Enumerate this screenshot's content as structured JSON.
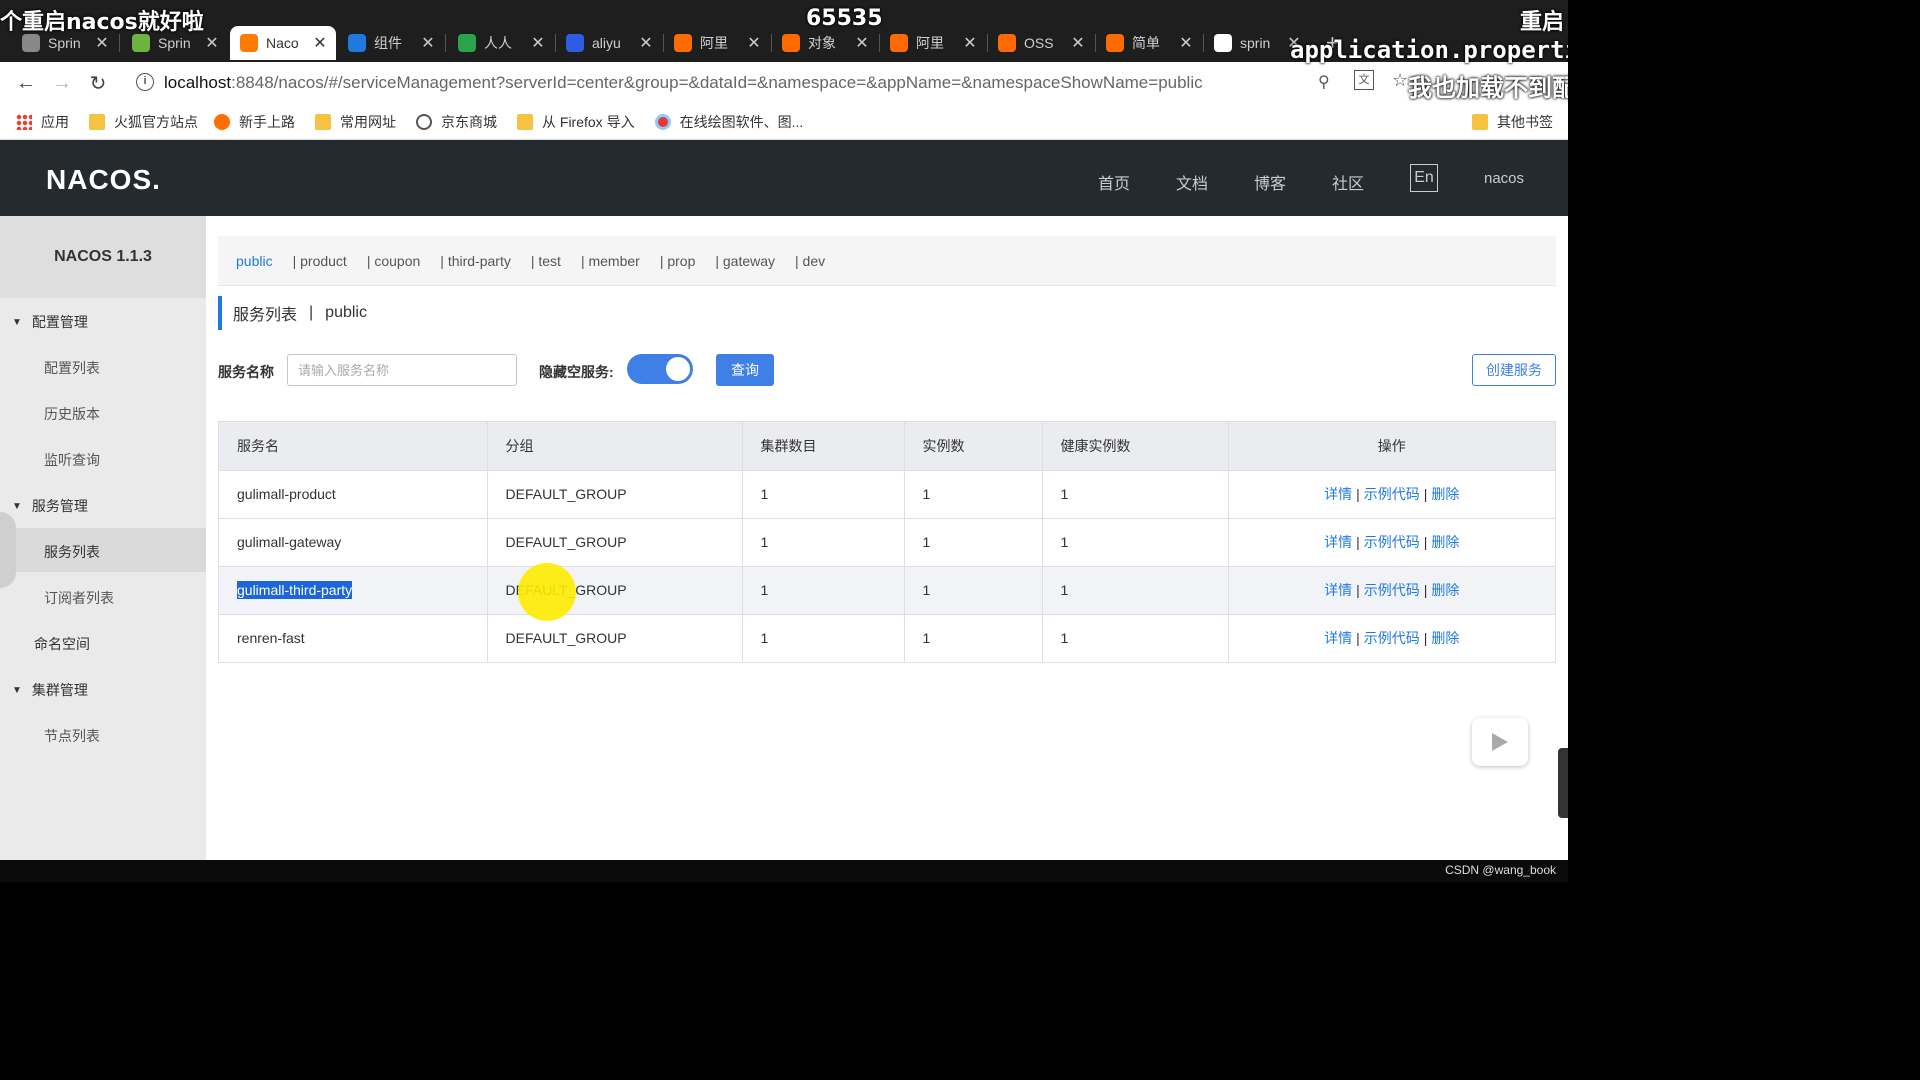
{
  "overlays": {
    "top_left": "个重启nacos就好啦",
    "top_center": "65535",
    "top_right": "重启",
    "right_line1": "application.properties",
    "right_line2": "我也加载不到配"
  },
  "browser": {
    "tabs": [
      {
        "title": "Sprin",
        "icon_color": "#888888"
      },
      {
        "title": "Sprin",
        "icon_color": "#6db33f"
      },
      {
        "title": "Naco",
        "icon_color": "#ff7a00"
      },
      {
        "title": "组件",
        "icon_color": "#1f7ae0"
      },
      {
        "title": "人人",
        "icon_color": "#2aa34a"
      },
      {
        "title": "aliyu",
        "icon_color": "#2f5ce6"
      },
      {
        "title": "阿里",
        "icon_color": "#ff6a00"
      },
      {
        "title": "对象",
        "icon_color": "#ff6a00"
      },
      {
        "title": "阿里",
        "icon_color": "#ff6a00"
      },
      {
        "title": "OSS",
        "icon_color": "#ff6a00"
      },
      {
        "title": "简单",
        "icon_color": "#ff6a00"
      },
      {
        "title": "sprin",
        "icon_color": "#ffffff"
      }
    ],
    "address": {
      "domain": "localhost",
      "rest": ":8848/nacos/#/serviceManagement?serverId=center&group=&dataId=&namespace=&appName=&namespaceShowName=public"
    },
    "bookmarks": {
      "apps": "应用",
      "items": [
        "火狐官方站点",
        "新手上路",
        "常用网址",
        "京东商城",
        "从 Firefox 导入",
        "在线绘图软件、图..."
      ],
      "other": "其他书签"
    }
  },
  "header": {
    "logo": "NACOS.",
    "nav": [
      "首页",
      "文档",
      "博客",
      "社区"
    ],
    "lang": "En",
    "user": "nacos"
  },
  "sidebar": {
    "version": "NACOS 1.1.3",
    "group_config": "配置管理",
    "config_list": "配置列表",
    "history": "历史版本",
    "listen_query": "监听查询",
    "group_service": "服务管理",
    "service_list": "服务列表",
    "subscribers": "订阅者列表",
    "namespace": "命名空间",
    "group_cluster": "集群管理",
    "node_list": "节点列表"
  },
  "namespaces": [
    "public",
    "| product",
    "| coupon",
    "| third-party",
    "| test",
    "| member",
    "| prop",
    "| gateway",
    "| dev"
  ],
  "page": {
    "title": "服务列表",
    "separator": "|",
    "namespace": "public",
    "search_label": "服务名称",
    "search_placeholder": "请输入服务名称",
    "hide_empty_label": "隐藏空服务:",
    "hide_empty_on": true,
    "query_button": "查询",
    "create_button": "创建服务"
  },
  "table": {
    "headers": [
      "服务名",
      "分组",
      "集群数目",
      "实例数",
      "健康实例数",
      "操作"
    ],
    "actions": [
      "详情",
      "示例代码",
      "删除"
    ],
    "rows": [
      {
        "name": "gulimall-product",
        "group": "DEFAULT_GROUP",
        "clusters": "1",
        "instances": "1",
        "healthy": "1"
      },
      {
        "name": "gulimall-gateway",
        "group": "DEFAULT_GROUP",
        "clusters": "1",
        "instances": "1",
        "healthy": "1"
      },
      {
        "name": "gulimall-third-party",
        "group": "DEFAULT_GROUP",
        "clusters": "1",
        "instances": "1",
        "healthy": "1"
      },
      {
        "name": "renren-fast",
        "group": "DEFAULT_GROUP",
        "clusters": "1",
        "instances": "1",
        "healthy": "1"
      }
    ]
  },
  "footer": {
    "credit": "CSDN @wang_book"
  }
}
